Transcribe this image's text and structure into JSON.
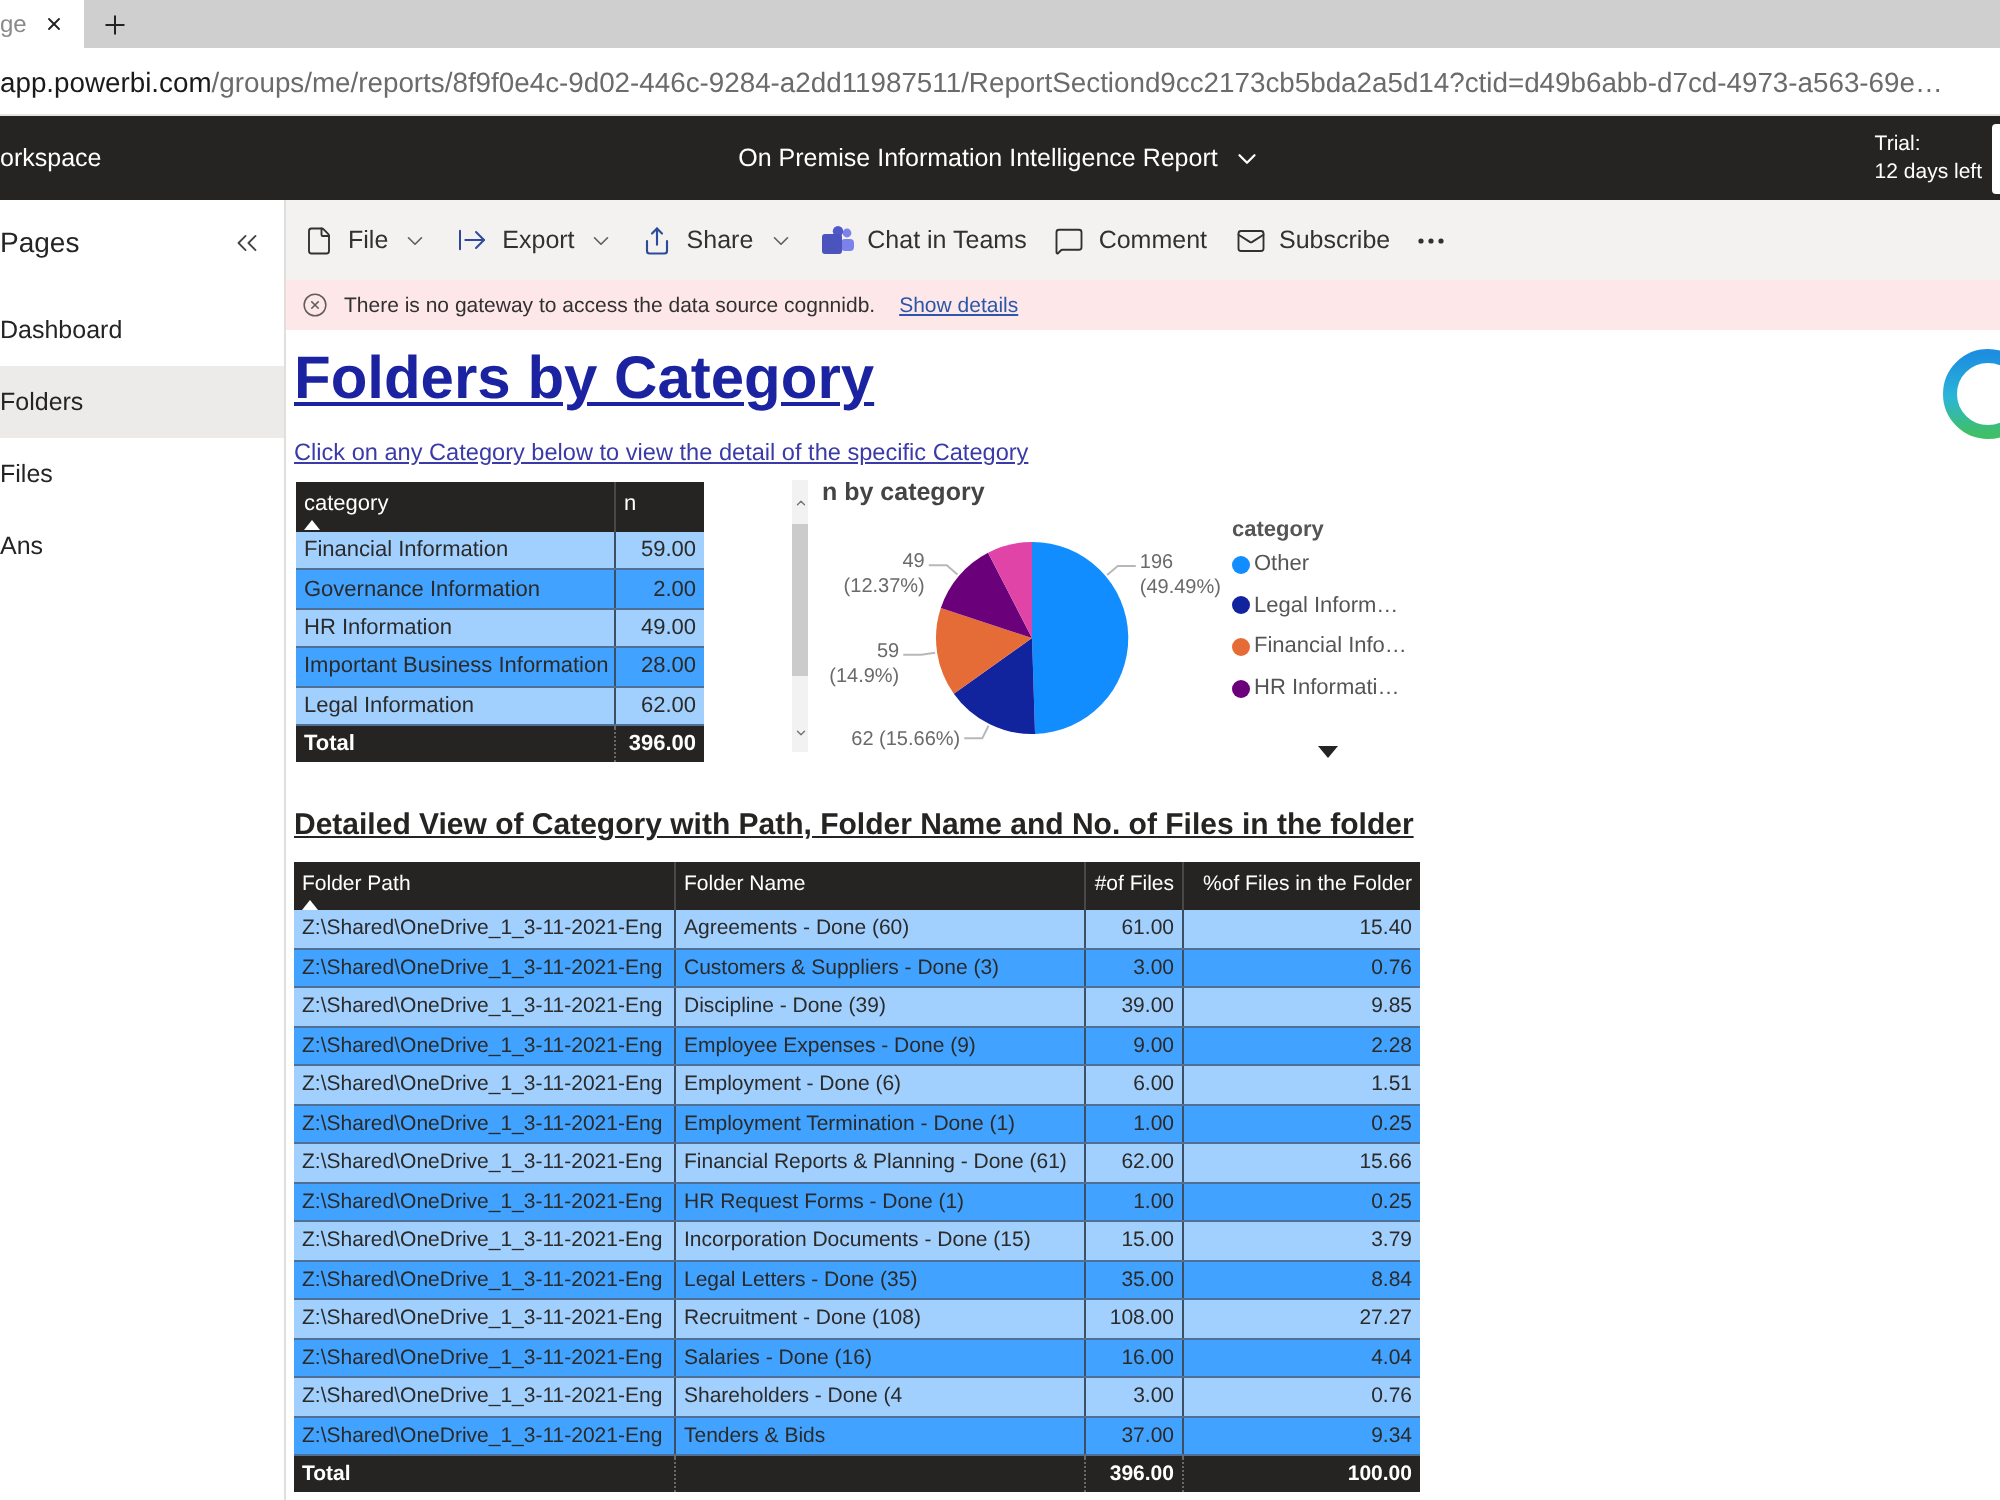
{
  "browser": {
    "tab_title": "ge",
    "url_host": "app.powerbi.com",
    "url_path": "/groups/me/reports/8f9f0e4c-9d02-446c-9284-a2dd11987511/ReportSectiond9cc2173cb5bda2a5d14?ctid=d49b6abb-d7cd-4973-a563-69e…"
  },
  "header": {
    "workspace": "orkspace",
    "report_title": "On Premise Information Intelligence Report",
    "trial_label": "Trial:",
    "trial_remaining": "12 days left"
  },
  "sidebar": {
    "title": "Pages",
    "items": [
      {
        "label": "Dashboard",
        "selected": false
      },
      {
        "label": "Folders",
        "selected": true
      },
      {
        "label": "Files",
        "selected": false
      },
      {
        "label": "Ans",
        "selected": false
      }
    ]
  },
  "toolbar": [
    {
      "kind": "file",
      "label": "File",
      "dropdown": true
    },
    {
      "kind": "export",
      "label": "Export",
      "dropdown": true
    },
    {
      "kind": "share",
      "label": "Share",
      "dropdown": true
    },
    {
      "kind": "teams",
      "label": "Chat in Teams",
      "dropdown": false
    },
    {
      "kind": "comment",
      "label": "Comment",
      "dropdown": false
    },
    {
      "kind": "subscribe",
      "label": "Subscribe",
      "dropdown": false
    },
    {
      "kind": "more",
      "dropdown": false
    }
  ],
  "error_banner": {
    "message": "There is no gateway to access the data source cognnidb.",
    "link": "Show details"
  },
  "report": {
    "title": "Folders by Category",
    "instruction": "Click on any Category below to view the detail of the specific Category",
    "category_table": {
      "columns": [
        {
          "label": "category",
          "sorted": true
        },
        {
          "label": "n",
          "sorted": false
        }
      ],
      "rows": [
        {
          "category": "Financial Information",
          "n": "59.00"
        },
        {
          "category": "Governance Information",
          "n": "2.00"
        },
        {
          "category": "HR Information",
          "n": "49.00"
        },
        {
          "category": "Important Business Information",
          "n": "28.00"
        },
        {
          "category": "Legal Information",
          "n": "62.00"
        }
      ],
      "total": {
        "label": "Total",
        "n": "396.00"
      }
    },
    "pie": {
      "title": "n by category",
      "legend_title": "category",
      "chart_data": {
        "type": "pie",
        "categories": [
          "Other",
          "Legal Inform…",
          "Financial Info…",
          "HR Informati…",
          null
        ],
        "values": [
          196,
          62,
          59,
          49,
          30
        ],
        "colors": [
          "#118dff",
          "#12239e",
          "#e66c37",
          "#6b007b",
          "#e044a7"
        ],
        "value_labels": [
          "196 (49.49%)",
          "62 (15.66%)",
          "59 (14.9%)",
          "49 (12.37%)",
          null
        ]
      }
    },
    "detail_heading": "Detailed View of Category with Path, Folder Name and No. of Files in the folder",
    "detail_table": {
      "columns": [
        {
          "label": "Folder Path",
          "sorted": true
        },
        {
          "label": "Folder Name",
          "sorted": false
        },
        {
          "label": "#of Files",
          "sorted": false
        },
        {
          "label": "%of Files in the Folder",
          "sorted": false
        }
      ],
      "rows": [
        {
          "path": "Z:\\Shared\\OneDrive_1_3-11-2021-Eng",
          "name": "Agreements - Done (60)",
          "files": "61.00",
          "percent": "15.40"
        },
        {
          "path": "Z:\\Shared\\OneDrive_1_3-11-2021-Eng",
          "name": "Customers & Suppliers - Done (3)",
          "files": "3.00",
          "percent": "0.76"
        },
        {
          "path": "Z:\\Shared\\OneDrive_1_3-11-2021-Eng",
          "name": "Discipline - Done (39)",
          "files": "39.00",
          "percent": "9.85"
        },
        {
          "path": "Z:\\Shared\\OneDrive_1_3-11-2021-Eng",
          "name": "Employee Expenses - Done (9)",
          "files": "9.00",
          "percent": "2.28"
        },
        {
          "path": "Z:\\Shared\\OneDrive_1_3-11-2021-Eng",
          "name": "Employment - Done (6)",
          "files": "6.00",
          "percent": "1.51"
        },
        {
          "path": "Z:\\Shared\\OneDrive_1_3-11-2021-Eng",
          "name": "Employment Termination - Done (1)",
          "files": "1.00",
          "percent": "0.25"
        },
        {
          "path": "Z:\\Shared\\OneDrive_1_3-11-2021-Eng",
          "name": "Financial Reports & Planning - Done (61)",
          "files": "62.00",
          "percent": "15.66"
        },
        {
          "path": "Z:\\Shared\\OneDrive_1_3-11-2021-Eng",
          "name": "HR Request Forms - Done (1)",
          "files": "1.00",
          "percent": "0.25"
        },
        {
          "path": "Z:\\Shared\\OneDrive_1_3-11-2021-Eng",
          "name": "Incorporation Documents - Done (15)",
          "files": "15.00",
          "percent": "3.79"
        },
        {
          "path": "Z:\\Shared\\OneDrive_1_3-11-2021-Eng",
          "name": "Legal Letters - Done (35)",
          "files": "35.00",
          "percent": "8.84"
        },
        {
          "path": "Z:\\Shared\\OneDrive_1_3-11-2021-Eng",
          "name": "Recruitment - Done (108)",
          "files": "108.00",
          "percent": "27.27"
        },
        {
          "path": "Z:\\Shared\\OneDrive_1_3-11-2021-Eng",
          "name": "Salaries - Done (16)",
          "files": "16.00",
          "percent": "4.04"
        },
        {
          "path": "Z:\\Shared\\OneDrive_1_3-11-2021-Eng",
          "name": "Shareholders - Done (4",
          "files": "3.00",
          "percent": "0.76"
        },
        {
          "path": "Z:\\Shared\\OneDrive_1_3-11-2021-Eng",
          "name": "Tenders & Bids",
          "files": "37.00",
          "percent": "9.34"
        }
      ],
      "total": {
        "label": "Total",
        "files": "396.00",
        "percent": "100.00"
      }
    }
  }
}
